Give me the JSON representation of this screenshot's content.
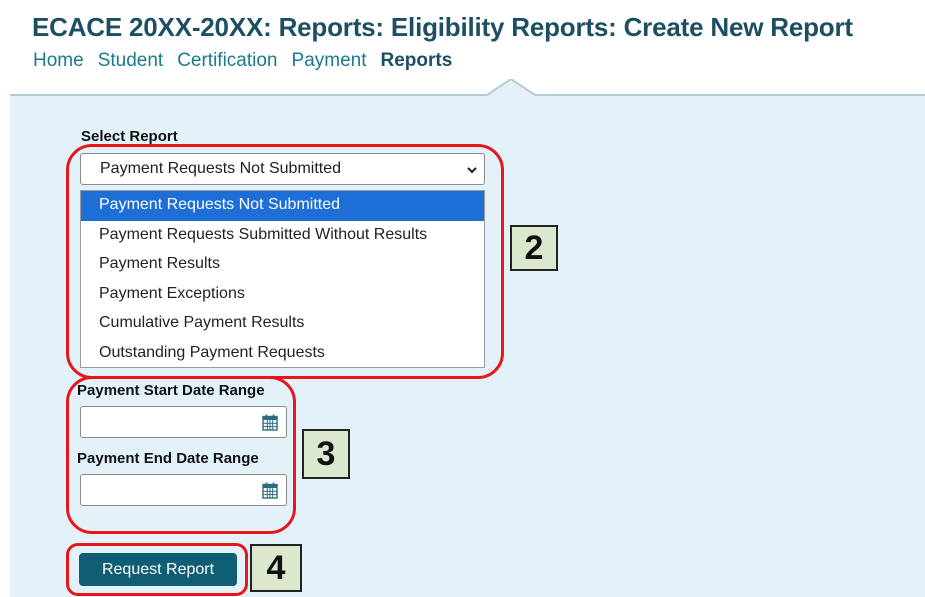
{
  "page": {
    "title": "ECACE 20XX-20XX: Reports: Eligibility Reports: Create New Report"
  },
  "nav": {
    "items": [
      "Home",
      "Student",
      "Certification",
      "Payment",
      "Reports"
    ],
    "active": "Reports"
  },
  "form": {
    "select_report": {
      "label": "Select Report",
      "value": "Payment Requests Not Submitted",
      "options": [
        "Payment Requests Not Submitted",
        "Payment Requests Submitted Without Results",
        "Payment Results",
        "Payment Exceptions",
        "Cumulative Payment Results",
        "Outstanding Payment Requests"
      ],
      "highlighted_option": "Payment Requests Not Submitted"
    },
    "start_date": {
      "label": "Payment Start Date Range",
      "value": ""
    },
    "end_date": {
      "label": "Payment End Date Range",
      "value": ""
    },
    "submit_label": "Request Report"
  },
  "callouts": [
    "2",
    "3",
    "4"
  ],
  "colors": {
    "title": "#1d4f63",
    "nav_link": "#1a7b8c",
    "panel_bg": "#e3f2f9",
    "option_selected": "#1e6ed8",
    "button": "#105e74",
    "highlight": "#e8151b",
    "callout_bg": "#dce8cd"
  },
  "icons": {
    "dropdown_arrow": "chevron-down-icon",
    "date_picker": "calendar-icon"
  }
}
